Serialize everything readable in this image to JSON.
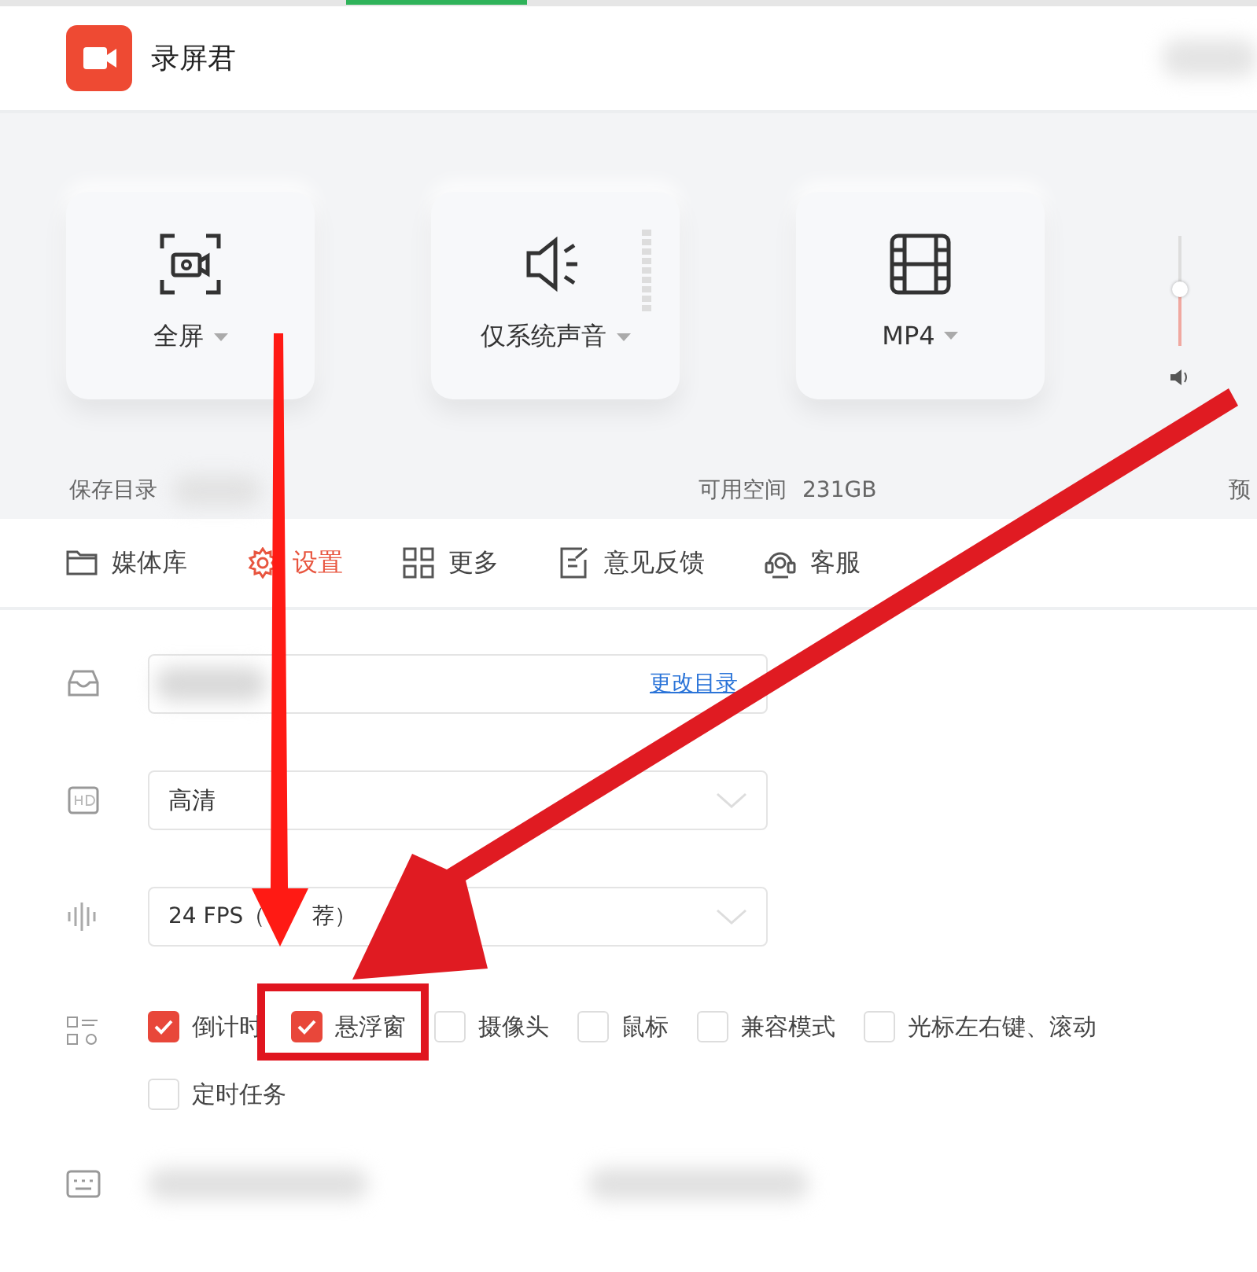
{
  "window": {
    "title": "录屏君"
  },
  "modes": [
    {
      "kind": "screen",
      "label": "全屏"
    },
    {
      "kind": "audio",
      "label": "仅系统声音"
    },
    {
      "kind": "film",
      "label": "MP4"
    }
  ],
  "volume": {
    "level": 0.52
  },
  "info": {
    "save_label": "保存目录",
    "space_label": "可用空间",
    "space_value": "231GB",
    "right_label": "预"
  },
  "nav": [
    {
      "kind": "folder",
      "label": "媒体库",
      "selected": false
    },
    {
      "kind": "gear",
      "label": "设置",
      "selected": true
    },
    {
      "kind": "grid",
      "label": "更多",
      "selected": false
    },
    {
      "kind": "note",
      "label": "意见反馈",
      "selected": false
    },
    {
      "kind": "headset",
      "label": "客服",
      "selected": false
    }
  ],
  "settings": {
    "directory_link": "更改目录",
    "quality": "高清",
    "fps_start": "24 FPS（",
    "fps_end": "荐）"
  },
  "options": [
    {
      "label": "倒计时",
      "checked": true
    },
    {
      "label": "悬浮窗",
      "checked": true
    },
    {
      "label": "摄像头",
      "checked": false
    },
    {
      "label": "鼠标",
      "checked": false
    },
    {
      "label": "兼容模式",
      "checked": false
    },
    {
      "label": "光标左右键、滚动",
      "checked": false
    },
    {
      "label": "定时任务",
      "checked": false
    }
  ]
}
